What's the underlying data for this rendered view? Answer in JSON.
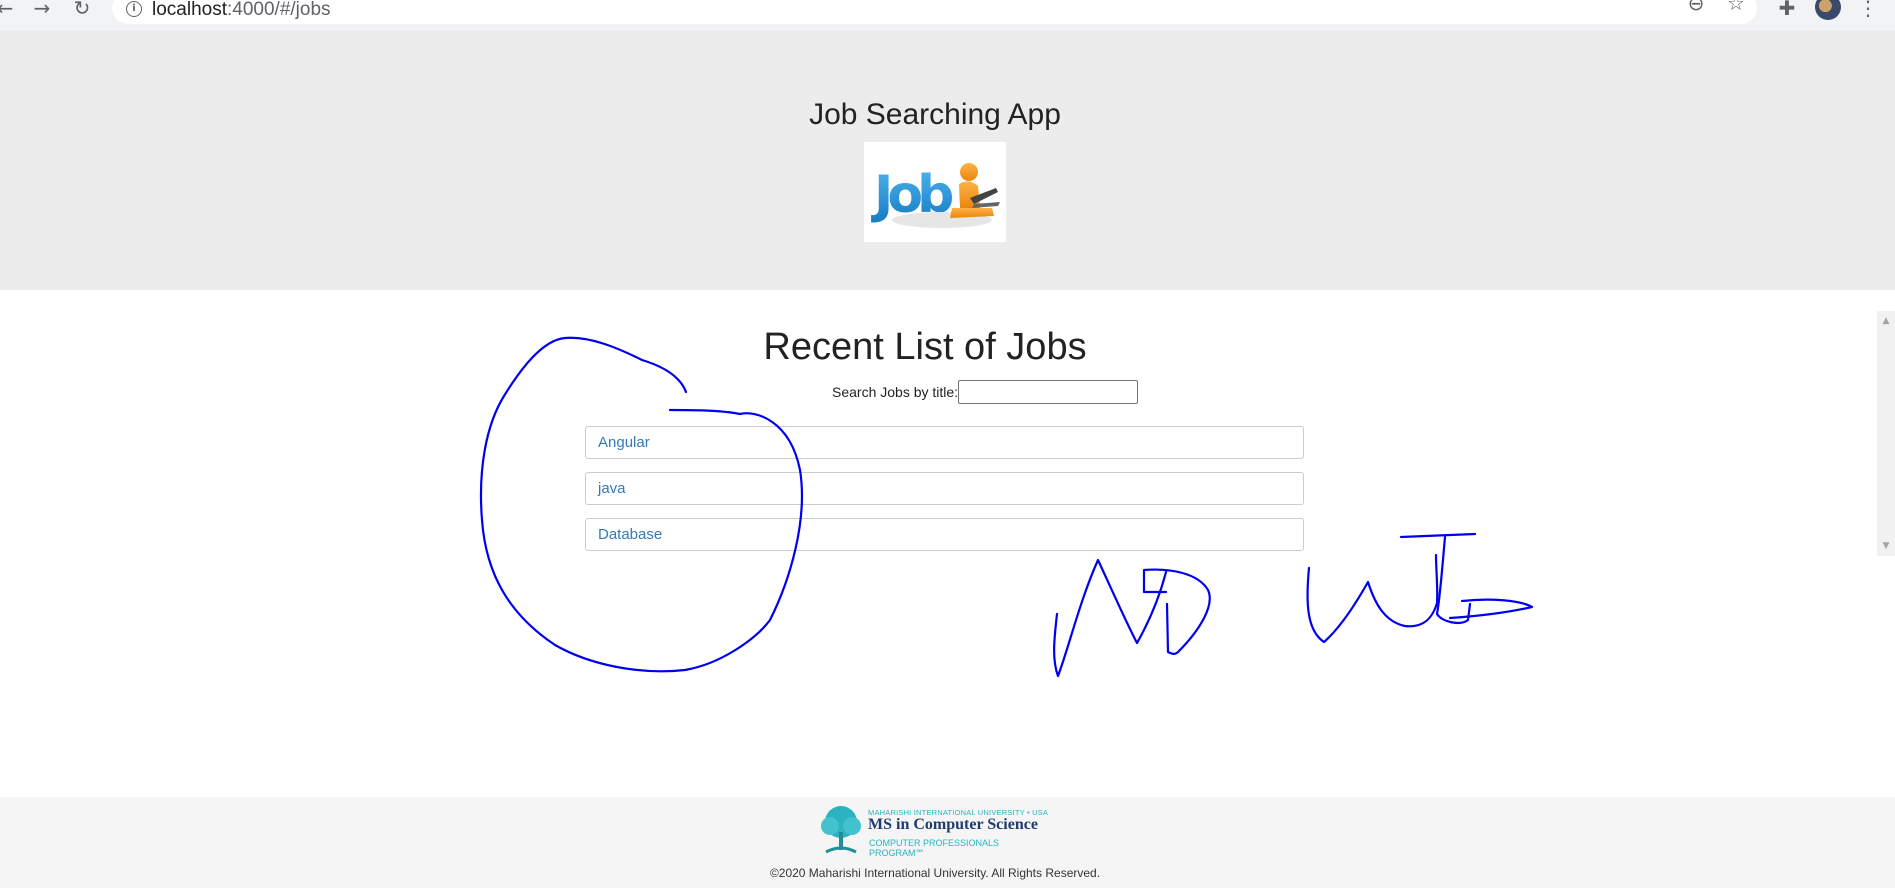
{
  "browser": {
    "url_host": "localhost",
    "url_path": ":4000/#/jobs",
    "icons": {
      "back": "back-arrow-icon",
      "forward": "forward-arrow-icon",
      "reload": "reload-icon",
      "info": "info-icon",
      "zoom": "zoom-out-icon",
      "bookmark": "star-icon",
      "extensions": "puzzle-icon",
      "profile": "avatar",
      "menu": "kebab-menu-icon"
    }
  },
  "header": {
    "title": "Job Searching App",
    "logo_text": "Job"
  },
  "main": {
    "title": "Recent List of Jobs",
    "search_label": "Search Jobs by title:",
    "search_value": "",
    "jobs": [
      {
        "title": "Angular"
      },
      {
        "title": "java"
      },
      {
        "title": "Database"
      }
    ]
  },
  "footer": {
    "university_line": "MAHARISHI INTERNATIONAL UNIVERSITY • USA",
    "program_line": "MS in Computer Science",
    "cpp_line": "COMPUTER PROFESSIONALS PROGRAM℠",
    "copyright": "©2020 Maharishi International University. All Rights Reserved."
  },
  "colors": {
    "header_bg": "#ececec",
    "link": "#337ab7",
    "annotation_ink": "#0000ee",
    "brand_teal": "#2bb3bf",
    "brand_navy": "#1f3c6e"
  }
}
